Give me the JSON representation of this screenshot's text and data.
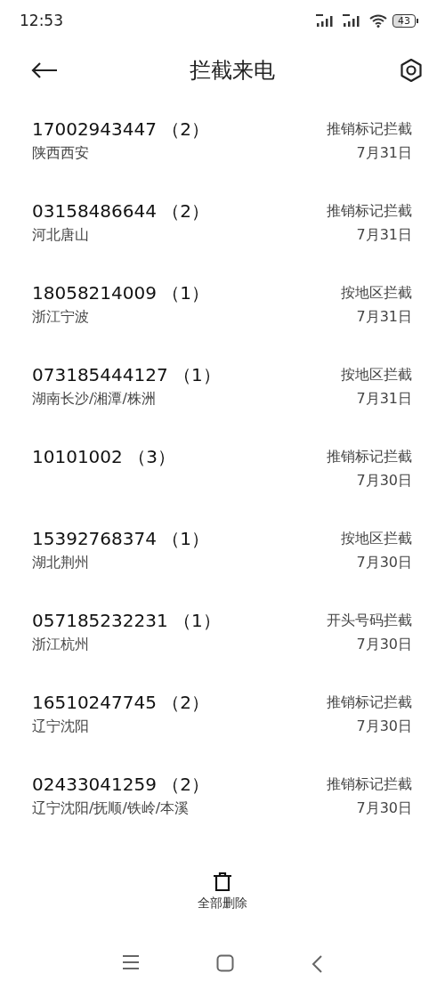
{
  "status_bar": {
    "time": "12:53",
    "battery": "43"
  },
  "header": {
    "title": "拦截来电"
  },
  "calls": [
    {
      "number": "17002943447 （2）",
      "location": "陕西西安",
      "reason": "推销标记拦截",
      "date": "7月31日"
    },
    {
      "number": "03158486644 （2）",
      "location": "河北唐山",
      "reason": "推销标记拦截",
      "date": "7月31日"
    },
    {
      "number": "18058214009 （1）",
      "location": "浙江宁波",
      "reason": "按地区拦截",
      "date": "7月31日"
    },
    {
      "number": "073185444127 （1）",
      "location": "湖南长沙/湘潭/株洲",
      "reason": "按地区拦截",
      "date": "7月31日"
    },
    {
      "number": "10101002 （3）",
      "reason": "推销标记拦截",
      "date": "7月30日"
    },
    {
      "number": "15392768374 （1）",
      "location": "湖北荆州",
      "reason": "按地区拦截",
      "date": "7月30日"
    },
    {
      "number": "057185232231 （1）",
      "location": "浙江杭州",
      "reason": "开头号码拦截",
      "date": "7月30日"
    },
    {
      "number": "16510247745 （2）",
      "location": "辽宁沈阳",
      "reason": "推销标记拦截",
      "date": "7月30日"
    },
    {
      "number": "02433041259 （2）",
      "location": "辽宁沈阳/抚顺/铁岭/本溪",
      "reason": "推销标记拦截",
      "date": "7月30日"
    }
  ],
  "bottom_action": {
    "label": "全部删除"
  }
}
